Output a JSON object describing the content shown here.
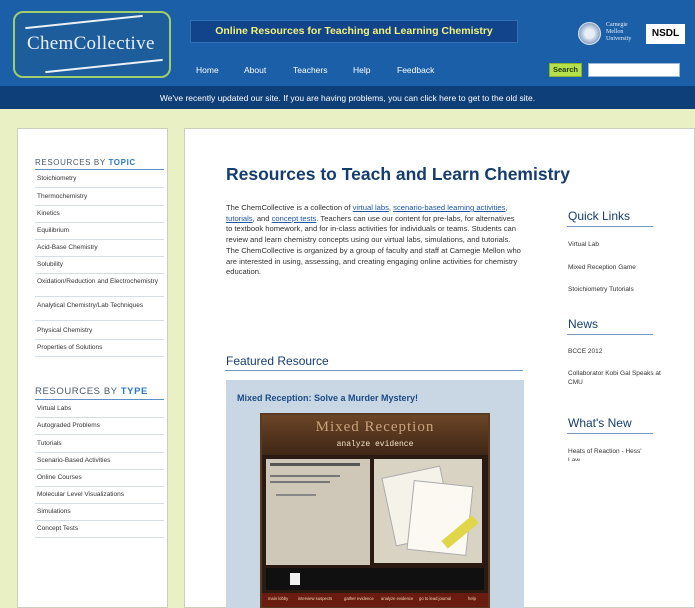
{
  "header": {
    "logo_text": "ChemCollective",
    "tagline": "Online Resources for Teaching and Learning Chemistry",
    "cmu_text_1": "Carnegie",
    "cmu_text_2": "Mellon",
    "cmu_text_3": "University",
    "nsdl_text": "NSDL",
    "nav": [
      "Home",
      "About",
      "Teachers",
      "Help",
      "Feedback"
    ],
    "search_label": "Search",
    "search_value": "",
    "notice": "We've recently updated our site. If you are having problems, you can click here to get to the old site."
  },
  "sidebar": {
    "topic_head_1": "RESOURCES BY",
    "topic_head_2": "TOPIC",
    "topics": [
      "Stoichiometry",
      "Thermochemistry",
      "Kinetics",
      "Equilibrium",
      "Acid-Base Chemistry",
      "Solubility",
      "Oxidation/Reduction and Electrochemistry",
      "Analytical Chemistry/Lab Techniques",
      "Physical Chemistry",
      "Properties of Solutions"
    ],
    "type_head_1": "RESOURCES BY",
    "type_head_2": "TYPE",
    "types": [
      "Virtual Labs",
      "Autograded Problems",
      "Tutorials",
      "Scenario-Based Activities",
      "Online Courses",
      "Molecular Level Visualizations",
      "Simulations",
      "Concept Tests"
    ]
  },
  "main": {
    "title": "Resources to Teach and Learn Chemistry",
    "intro_1": "The ChemCollective is a collection of ",
    "link_virtual_labs": "virtual labs",
    "intro_2": ", ",
    "link_scenario": "scenario-based learning activities",
    "intro_3": ", ",
    "link_tutorials": "tutorials",
    "intro_4": ", and ",
    "link_concept": "concept tests",
    "intro_5": ". Teachers can use our content for pre-labs, for alternatives to textbook homework, and for in-class activities for individuals or teams. Students can review and learn chemistry concepts using our virtual labs, simulations, and tutorials. The ChemCollective is organized by a group of faculty and staff at Carnegie Mellon who are interested in using, assessing, and creating engaging online activities for chemistry education.",
    "featured_title": "Featured Resource",
    "featured_heading": "Mixed Reception: Solve a Murder Mystery!",
    "game_title": "Mixed Reception",
    "game_subtitle": "analyze evidence",
    "game_nav": [
      "main lobby",
      "interview suspects",
      "gather evidence",
      "analyze evidence",
      "go to lead journal",
      "help"
    ]
  },
  "right": {
    "quick_links_title": "Quick Links",
    "quick_links": [
      "Virtual Lab",
      "Mixed Reception Game",
      "Stoichiometry Tutorials"
    ],
    "news_title": "News",
    "news": [
      "BCCE 2012",
      "Collaborator Kobi Gal Speaks at CMU"
    ],
    "whats_new_title": "What's New",
    "whats_new": [
      "Heats of Reaction - Hess' Law"
    ]
  },
  "colors": {
    "header_blue": "#1a5fa8",
    "notice_blue": "#0f3f78",
    "page_bg": "#e8f0c4",
    "title_navy": "#163d6f",
    "accent_yellow": "#f2f27a",
    "search_green": "#b6e04a"
  }
}
